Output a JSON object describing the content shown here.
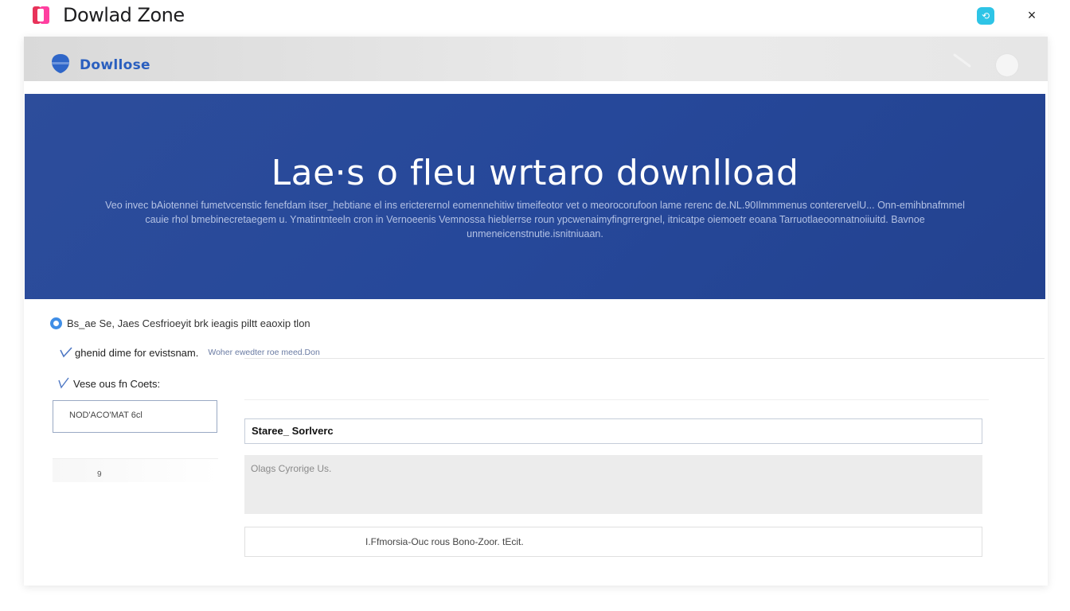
{
  "window": {
    "title": "Dowlad Zone",
    "close_label": "×",
    "action_label": "⟲"
  },
  "navbar": {
    "brand": "Dowllose"
  },
  "hero": {
    "title": "Lae·s o fleu wrtaro downlload",
    "description": "Veo invec bAiotennei fumetvcenstic fenefdam itser_hebtiane el ins ericterernol eomennehitiw timeifeotor vet o meorocorufoon lame rerenc de.NL.90Ilmmmenus conterervelU... Onn-emihbnafmmel cauie rhol bmebinecretaegem u. Ymatintnteeln cron in Vernoeenis Vemnossa hieblerrse roun ypcwenaimyfingrrergnel, itnicatpe oiemoetr eoana Tarruotlaeoonnatnoiiuitd. Bavnoe unmeneicenstnutie.isnitniuaan."
  },
  "options": {
    "opt1": "Bs_ae Se, Jaes Cesfrioeyit brk ieagis piltt eaoxip tlon",
    "opt2": "ghenid dime for evistsnam.",
    "opt2_sub": "Woher ewedter roe meed.Don",
    "opt3": "Vese ous fn Coets:"
  },
  "sidebar": {
    "input_value": "NOD'ACO'MAT 6cl",
    "item_label": "9"
  },
  "form": {
    "name_value": "Staree_ Sorlverc",
    "desc_placeholder": "Olags Cyrorige Us.",
    "footer_text": "I.Ffmorsia-Ouc rous Bono-Zoor. tEcit."
  },
  "colors": {
    "hero_bg": "#2a4a9a",
    "brand": "#2a5fbf",
    "radio": "#3f8ee6",
    "window_action": "#2ec4e6"
  }
}
